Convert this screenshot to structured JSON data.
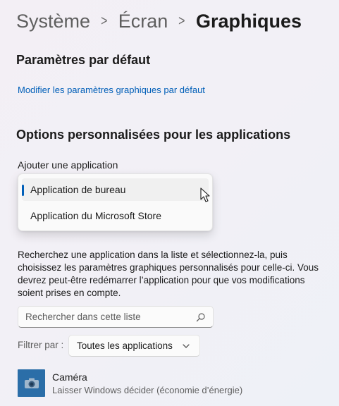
{
  "breadcrumb": {
    "items": [
      "Système",
      "Écran"
    ],
    "current": "Graphiques"
  },
  "defaults_section": {
    "title": "Paramètres par défaut",
    "link": "Modifier les paramètres graphiques par défaut"
  },
  "custom_section": {
    "title": "Options personnalisées pour les applications",
    "add_label": "Ajouter une application",
    "dropdown_options": [
      {
        "label": "Application de bureau",
        "selected": true
      },
      {
        "label": "Application du Microsoft Store",
        "selected": false
      }
    ],
    "description": "Recherchez une application dans la liste et sélectionnez-la, puis choisissez les paramètres graphiques personnalisés pour celle-ci. Vous devrez peut-être redémarrer l’application pour que vos modifications soient prises en compte."
  },
  "search": {
    "placeholder": "Rechercher dans cette liste",
    "icon": "search-icon"
  },
  "filter": {
    "label": "Filtrer par :",
    "selected": "Toutes les applications",
    "icon": "chevron-down-icon"
  },
  "apps": [
    {
      "name": "Caméra",
      "setting": "Laisser Windows décider (économie d’énergie)",
      "icon": "camera-icon",
      "icon_color": "#2b6ea8"
    }
  ],
  "colors": {
    "accent": "#005fb8"
  }
}
